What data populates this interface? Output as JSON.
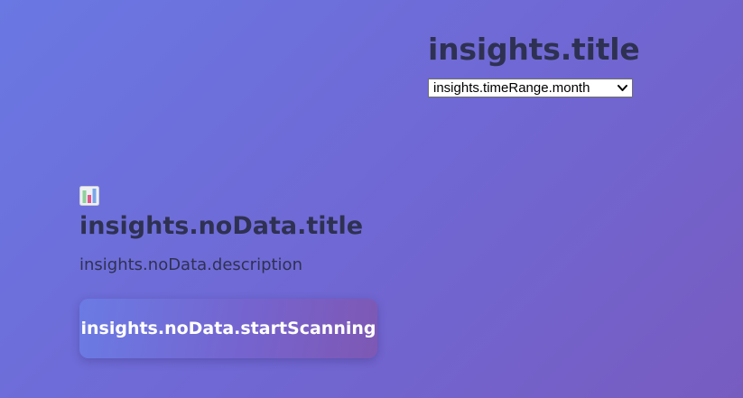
{
  "header": {
    "title": "insights.title"
  },
  "time_range": {
    "selected": "insights.timeRange.month"
  },
  "empty_state": {
    "icon": "bar-chart-icon",
    "title": "insights.noData.title",
    "description": "insights.noData.description",
    "button_label": "insights.noData.startScanning"
  },
  "colors": {
    "background_start": "#6a78e3",
    "background_end": "#775cc0",
    "text": "#2f3152",
    "button_text": "#ffffff"
  }
}
